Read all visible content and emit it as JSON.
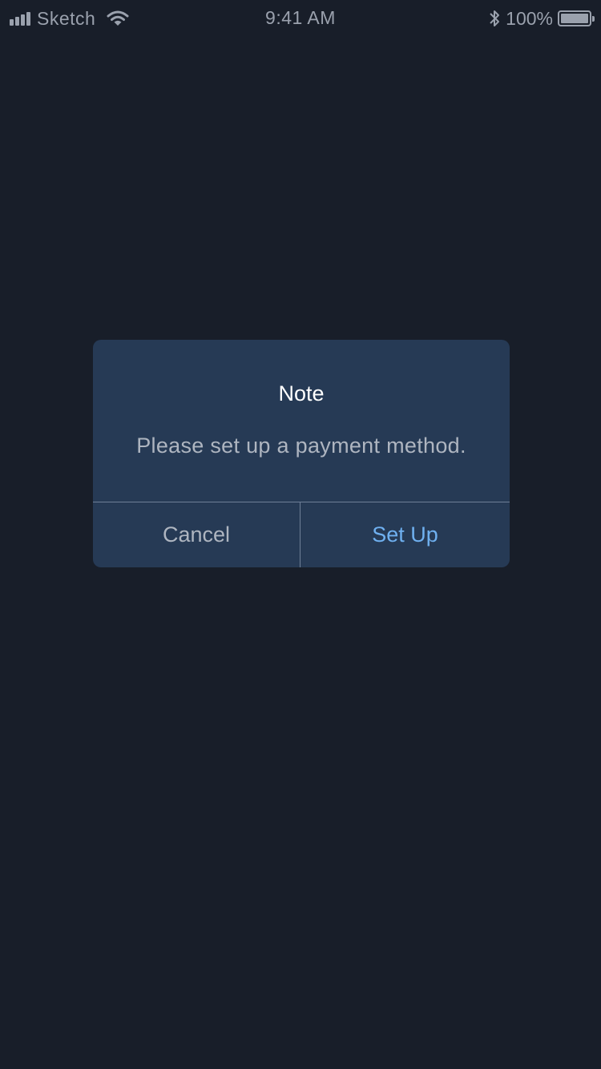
{
  "status_bar": {
    "carrier": "Sketch",
    "time": "9:41 AM",
    "battery_percent": "100%",
    "battery_level": 1.0,
    "signal_icon": "signal-bars-icon",
    "wifi_icon": "wifi-icon",
    "bluetooth_icon": "bluetooth-icon",
    "battery_icon": "battery-icon"
  },
  "alert": {
    "title": "Note",
    "message": "Please set up a payment method.",
    "cancel_label": "Cancel",
    "confirm_label": "Set Up"
  },
  "colors": {
    "background": "#181e29",
    "dialog": "#263a55",
    "accent": "#6fb0f0",
    "secondary_text": "#aeb5c0"
  }
}
